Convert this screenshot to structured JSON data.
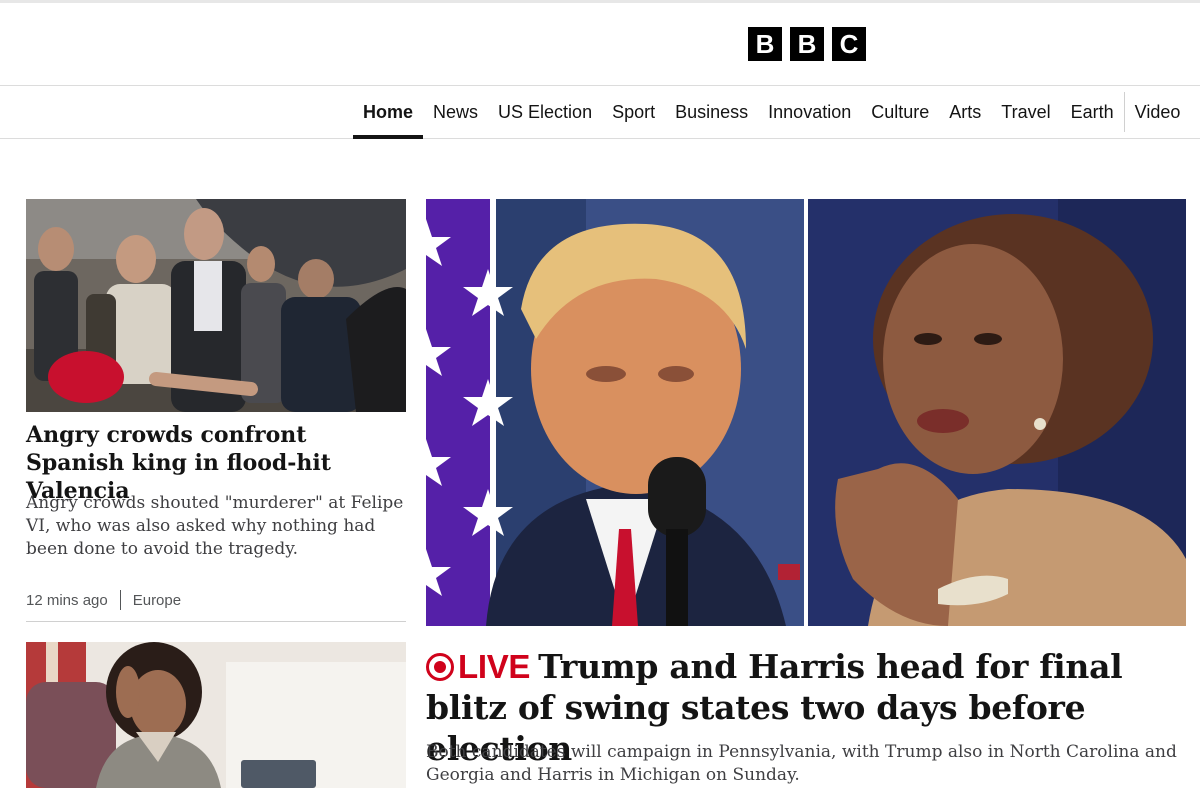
{
  "header": {
    "logo_letters": [
      "B",
      "B",
      "C"
    ]
  },
  "nav": {
    "items": [
      {
        "label": "Home",
        "active": true
      },
      {
        "label": "News"
      },
      {
        "label": "US Election"
      },
      {
        "label": "Sport"
      },
      {
        "label": "Business"
      },
      {
        "label": "Innovation"
      },
      {
        "label": "Culture"
      },
      {
        "label": "Arts"
      },
      {
        "label": "Travel"
      },
      {
        "label": "Earth"
      },
      {
        "label": "Video"
      }
    ]
  },
  "stories": {
    "left": {
      "headline": "Angry crowds confront Spanish king in flood-hit Valencia",
      "summary": "Angry crowds shouted \"murderer\" at Felipe VI, who was also asked why nothing had been done to avoid the tragedy.",
      "time": "12 mins ago",
      "category": "Europe"
    },
    "main": {
      "live_label": "LIVE",
      "headline": "Trump and Harris head for final blitz of swing states two days before election",
      "summary": "Both candidates will campaign in Pennsylvania, with Trump also in North Carolina and Georgia and Harris in Michigan on Sunday."
    }
  },
  "colors": {
    "live_red": "#d0021b",
    "flag_purple": "#5520a8",
    "text": "#141414"
  }
}
